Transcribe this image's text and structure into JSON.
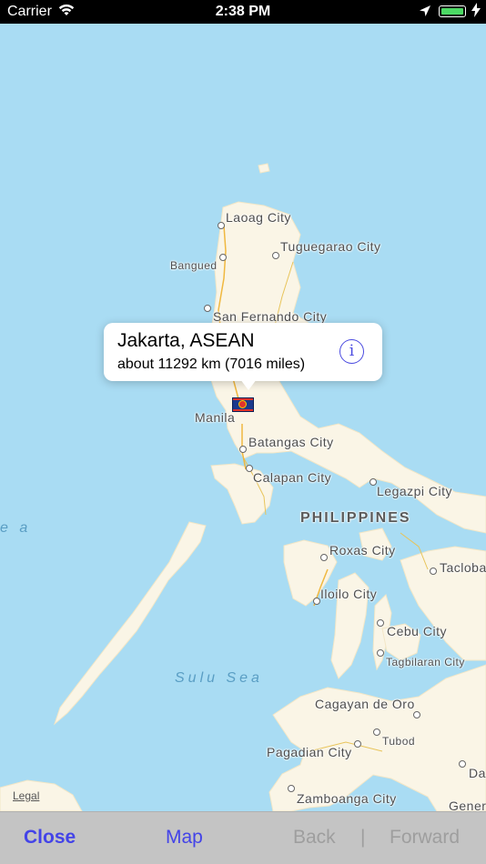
{
  "status_bar": {
    "carrier": "Carrier",
    "time": "2:38 PM",
    "battery_color": "#4cd964"
  },
  "callout": {
    "title": "Jakarta, ASEAN",
    "subtitle": "about 11292 km (7016 miles)",
    "info_icon": "i",
    "info_color": "#4a4ae0"
  },
  "map": {
    "water_color": "#a9dcf3",
    "land_color": "#faf5e6",
    "country_label": "PHILIPPINES",
    "sea_labels": {
      "sulu": "Sulu Sea",
      "left_fragment": "e a"
    },
    "cities": {
      "laoag": "Laoag City",
      "tuguegarao": "Tuguegarao City",
      "bangued": "Bangued",
      "san_fernando": "San Fernando City",
      "manila": "Manila",
      "batangas": "Batangas City",
      "calapan": "Calapan City",
      "legazpi": "Legazpi City",
      "roxas": "Roxas City",
      "tacloban": "Taclobа",
      "iloilo": "Iloilo City",
      "cebu": "Cebu City",
      "tagbilaran": "Tagbilaran City",
      "cagayan": "Cagayan de Oro",
      "tubod": "Tubod",
      "pagadian": "Pagadian City",
      "zamboanga": "Zamboanga City",
      "davao_fragment": "Da",
      "general_fragment": "Gener"
    },
    "legal": "Legal"
  },
  "toolbar": {
    "close": "Close",
    "map": "Map",
    "back": "Back",
    "separator": "|",
    "forward": "Forward",
    "active_color": "#4343e8",
    "disabled_color": "#9e9e9e"
  }
}
